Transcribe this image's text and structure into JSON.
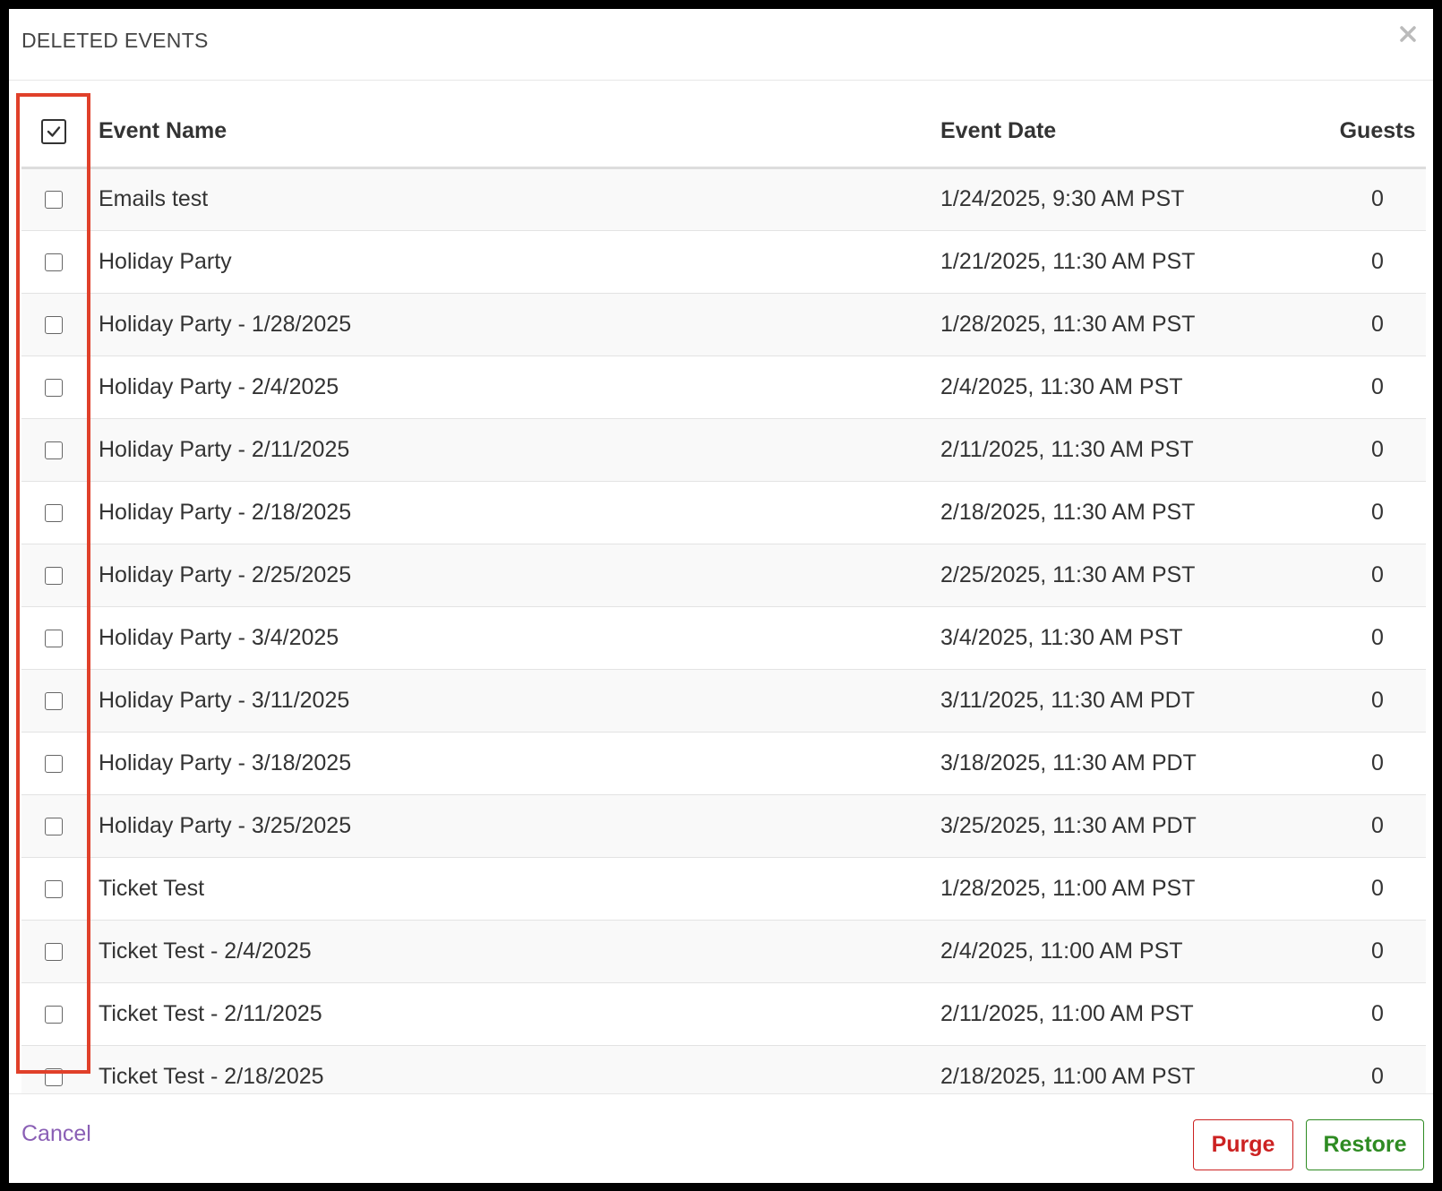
{
  "modal": {
    "title": "DELETED EVENTS",
    "close_icon": "close-icon"
  },
  "table": {
    "select_all_checked": true,
    "headers": {
      "name": "Event Name",
      "date": "Event Date",
      "guests": "Guests"
    },
    "rows": [
      {
        "name": "Emails test",
        "date": "1/24/2025, 9:30 AM PST",
        "guests": "0",
        "checked": false
      },
      {
        "name": "Holiday Party",
        "date": "1/21/2025, 11:30 AM PST",
        "guests": "0",
        "checked": false
      },
      {
        "name": "Holiday Party - 1/28/2025",
        "date": "1/28/2025, 11:30 AM PST",
        "guests": "0",
        "checked": false
      },
      {
        "name": "Holiday Party - 2/4/2025",
        "date": "2/4/2025, 11:30 AM PST",
        "guests": "0",
        "checked": false
      },
      {
        "name": "Holiday Party - 2/11/2025",
        "date": "2/11/2025, 11:30 AM PST",
        "guests": "0",
        "checked": false
      },
      {
        "name": "Holiday Party - 2/18/2025",
        "date": "2/18/2025, 11:30 AM PST",
        "guests": "0",
        "checked": false
      },
      {
        "name": "Holiday Party - 2/25/2025",
        "date": "2/25/2025, 11:30 AM PST",
        "guests": "0",
        "checked": false
      },
      {
        "name": "Holiday Party - 3/4/2025",
        "date": "3/4/2025, 11:30 AM PST",
        "guests": "0",
        "checked": false
      },
      {
        "name": "Holiday Party - 3/11/2025",
        "date": "3/11/2025, 11:30 AM PDT",
        "guests": "0",
        "checked": false
      },
      {
        "name": "Holiday Party - 3/18/2025",
        "date": "3/18/2025, 11:30 AM PDT",
        "guests": "0",
        "checked": false
      },
      {
        "name": "Holiday Party - 3/25/2025",
        "date": "3/25/2025, 11:30 AM PDT",
        "guests": "0",
        "checked": false
      },
      {
        "name": "Ticket Test",
        "date": "1/28/2025, 11:00 AM PST",
        "guests": "0",
        "checked": false
      },
      {
        "name": "Ticket Test - 2/4/2025",
        "date": "2/4/2025, 11:00 AM PST",
        "guests": "0",
        "checked": false
      },
      {
        "name": "Ticket Test - 2/11/2025",
        "date": "2/11/2025, 11:00 AM PST",
        "guests": "0",
        "checked": false
      },
      {
        "name": "Ticket Test - 2/18/2025",
        "date": "2/18/2025, 11:00 AM PST",
        "guests": "0",
        "checked": false
      }
    ]
  },
  "footer": {
    "cancel_label": "Cancel",
    "purge_label": "Purge",
    "restore_label": "Restore"
  },
  "colors": {
    "highlight": "#e0402a",
    "cancel": "#8a5fb5",
    "purge": "#cc2222",
    "restore": "#2e8b22"
  }
}
